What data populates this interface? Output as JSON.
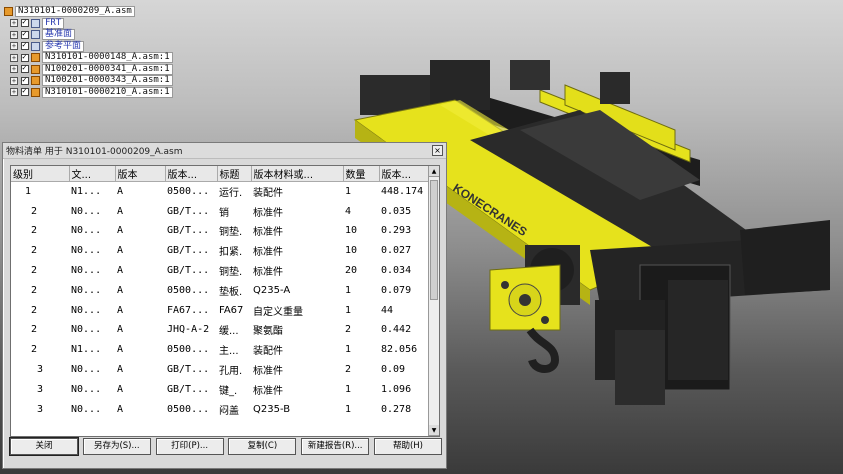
{
  "tree": {
    "root": "N310101-0000209_A.asm",
    "items": [
      {
        "label": "FRT",
        "type": "plane",
        "color": "#2a3bb0"
      },
      {
        "label": "基准面",
        "type": "plane",
        "color": "#2a3bb0"
      },
      {
        "label": "参考平面",
        "type": "plane",
        "color": "#2a3bb0"
      },
      {
        "label": "N310101-0000148_A.asm:1",
        "type": "asm",
        "color": "#111111"
      },
      {
        "label": "N100201-0000341_A.asm:1",
        "type": "asm",
        "color": "#111111"
      },
      {
        "label": "N100201-0000343_A.asm:1",
        "type": "asm",
        "color": "#111111"
      },
      {
        "label": "N310101-0000210_A.asm:1",
        "type": "asm",
        "color": "#111111"
      }
    ]
  },
  "dialog": {
    "title": "物料清单  用于  N310101-0000209_A.asm",
    "close": "×",
    "columns": [
      "级别",
      "文...",
      "版本",
      "版本...",
      "标题",
      "版本材料或...",
      "数量",
      "版本..."
    ],
    "rows": [
      [
        "1",
        "N1...",
        "A",
        "0500...",
        "运行.",
        "装配件",
        "1",
        "448.174"
      ],
      [
        "2",
        "N0...",
        "A",
        "GB/T...",
        "销",
        "标准件",
        "4",
        "0.035"
      ],
      [
        "2",
        "N0...",
        "A",
        "GB/T...",
        "铜垫.",
        "标准件",
        "10",
        "0.293"
      ],
      [
        "2",
        "N0...",
        "A",
        "GB/T...",
        "扣紧.",
        "标准件",
        "10",
        "0.027"
      ],
      [
        "2",
        "N0...",
        "A",
        "GB/T...",
        "铜垫.",
        "标准件",
        "20",
        "0.034"
      ],
      [
        "2",
        "N0...",
        "A",
        "0500...",
        "垫板.",
        "Q235-A",
        "1",
        "0.079"
      ],
      [
        "2",
        "N0...",
        "A",
        "FA67...",
        "FA67",
        "自定义重量",
        "1",
        "44"
      ],
      [
        "2",
        "N0...",
        "A",
        "JHQ-A-2",
        "缓...",
        "聚氨酯",
        "2",
        "0.442"
      ],
      [
        "2",
        "N1...",
        "A",
        "0500...",
        "主...",
        "装配件",
        "1",
        "82.056"
      ],
      [
        "3",
        "N0...",
        "A",
        "GB/T...",
        "孔用.",
        "标准件",
        "2",
        "0.09"
      ],
      [
        "3",
        "N0...",
        "A",
        "GB/T...",
        "键_.",
        "标准件",
        "1",
        "1.096"
      ],
      [
        "3",
        "N0...",
        "A",
        "0500...",
        "闷盖",
        "Q235-B",
        "1",
        "0.278"
      ]
    ],
    "buttons": [
      "关闭",
      "另存为(S)...",
      "打印(P)...",
      "复制(C)",
      "新建报告(R)...",
      "帮助(H)"
    ]
  },
  "crane": {
    "brand": "KONECRANES",
    "colors": {
      "body": "#e6e21c",
      "dark": "#1f1f1f",
      "mid": "#3b3b3b"
    }
  }
}
